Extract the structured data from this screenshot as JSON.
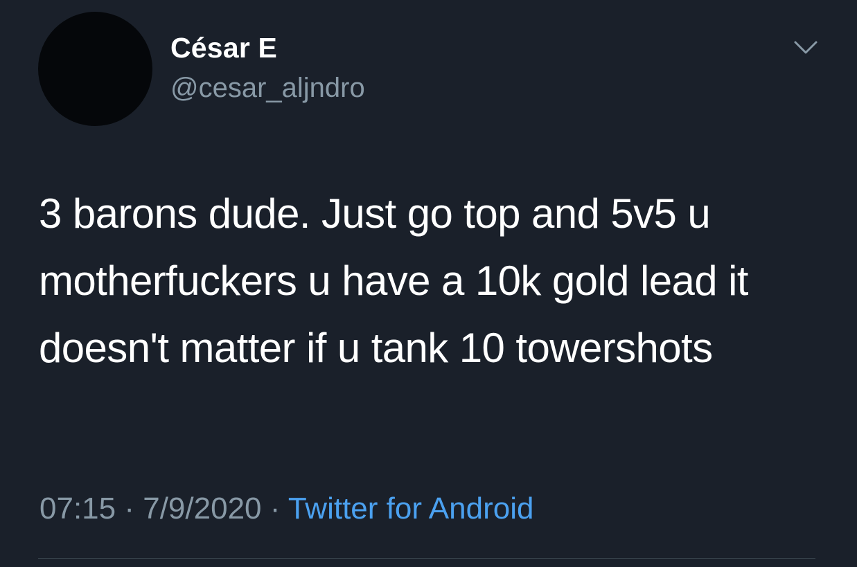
{
  "author": {
    "display_name": "César E",
    "handle": "@cesar_aljndro"
  },
  "tweet": {
    "text": "3 barons dude. Just go top and 5v5 u motherfuckers u have a 10k gold lead it doesn't matter if u tank 10 towershots"
  },
  "meta": {
    "time": "07:15",
    "separator": "·",
    "date": "7/9/2020",
    "source": "Twitter for Android"
  },
  "icons": {
    "menu": "chevron-down-icon",
    "avatar": "avatar"
  },
  "colors": {
    "background": "#1a202a",
    "text_primary": "#ffffff",
    "text_secondary": "#8899a6",
    "link": "#4ba1f0",
    "divider": "#38444d"
  }
}
